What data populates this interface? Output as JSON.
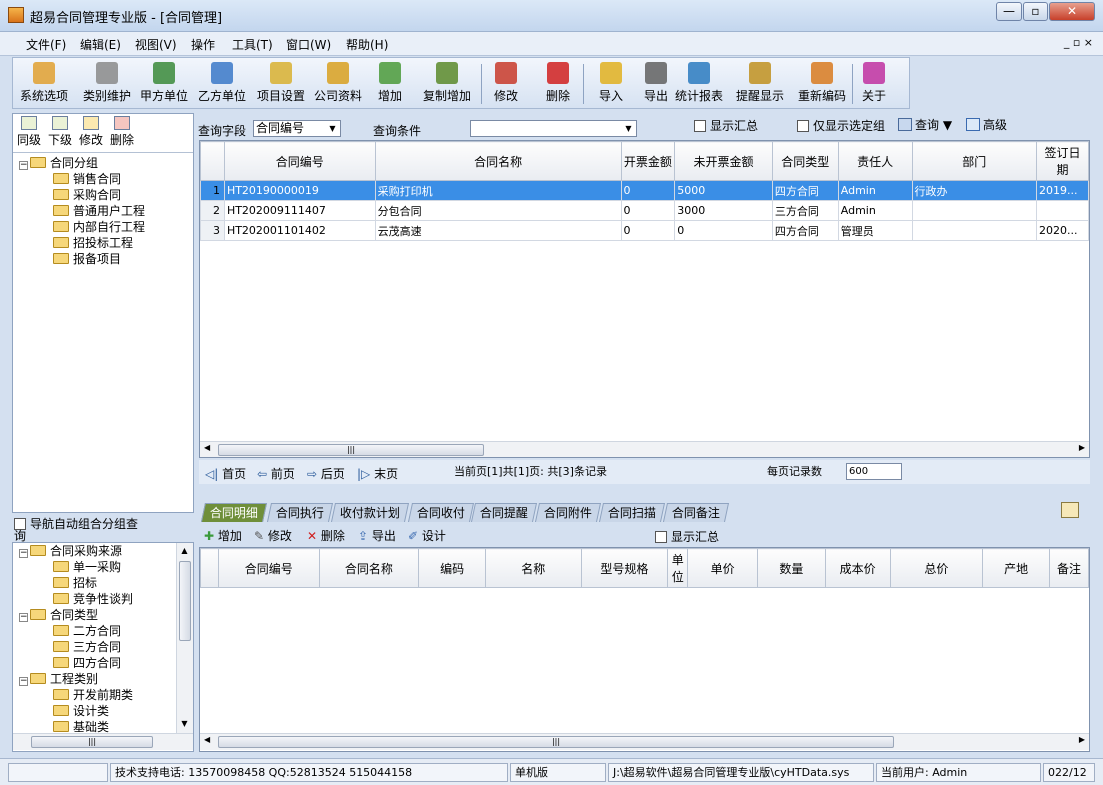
{
  "window": {
    "title": "超易合同管理专业版 - [合同管理]",
    "min": "0",
    "max": "1",
    "close": "r"
  },
  "menu": [
    "文件(F)",
    "编辑(E)",
    "视图(V)",
    "操作",
    "工具(T)",
    "窗口(W)",
    "帮助(H)"
  ],
  "mdi_controls": "_ ▫ ×",
  "toolbar": [
    {
      "label": "系统选项",
      "icon": "hammer-icon",
      "color": "#e0a030"
    },
    {
      "label": "类别维护",
      "icon": "tools-icon",
      "color": "#8a8a8a"
    },
    {
      "label": "甲方单位",
      "icon": "globe-user-icon",
      "color": "#3a8a3a"
    },
    {
      "label": "乙方单位",
      "icon": "user-icon",
      "color": "#3a78c8"
    },
    {
      "label": "项目设置",
      "icon": "coins-icon",
      "color": "#d8b030"
    },
    {
      "label": "公司资料",
      "icon": "money-icon",
      "color": "#d8a020"
    },
    {
      "label": "增加",
      "icon": "add-user-icon",
      "color": "#4a9a3a"
    },
    {
      "label": "复制增加",
      "icon": "copy-add-icon",
      "color": "#5a8a2a"
    },
    {
      "label": "修改",
      "icon": "pen-icon",
      "color": "#c83a2a"
    },
    {
      "label": "删除",
      "icon": "delete-x-icon",
      "color": "#d02020"
    },
    {
      "label": "导入",
      "icon": "folder-import-icon",
      "color": "#e0b020"
    },
    {
      "label": "导出",
      "icon": "printer-icon",
      "color": "#606060"
    },
    {
      "label": "统计报表",
      "icon": "bar-chart-icon",
      "color": "#2a7ac0"
    },
    {
      "label": "提醒显示",
      "icon": "warning-icon",
      "color": "#c09020"
    },
    {
      "label": "重新编码",
      "icon": "calculator-icon",
      "color": "#d87a20"
    },
    {
      "label": "关于",
      "icon": "question-icon",
      "color": "#c030a0"
    }
  ],
  "left_buttons": [
    "同级",
    "下级",
    "修改",
    "删除"
  ],
  "tree1": [
    {
      "label": "合同分组",
      "level": 0,
      "expand": "−"
    },
    {
      "label": "销售合同",
      "level": 1
    },
    {
      "label": "采购合同",
      "level": 1
    },
    {
      "label": "普通用户工程",
      "level": 1
    },
    {
      "label": "内部自行工程",
      "level": 1
    },
    {
      "label": "招投标工程",
      "level": 1
    },
    {
      "label": "报备项目",
      "level": 1
    }
  ],
  "nav_checkbox": "导航自动组合分组查询",
  "tree2": [
    {
      "label": "合同采购来源",
      "level": 0,
      "expand": "−"
    },
    {
      "label": "单一采购",
      "level": 1
    },
    {
      "label": "招标",
      "level": 1
    },
    {
      "label": "竞争性谈判",
      "level": 1
    },
    {
      "label": "合同类型",
      "level": 0,
      "expand": "−"
    },
    {
      "label": "二方合同",
      "level": 1
    },
    {
      "label": "三方合同",
      "level": 1
    },
    {
      "label": "四方合同",
      "level": 1
    },
    {
      "label": "工程类别",
      "level": 0,
      "expand": "−"
    },
    {
      "label": "开发前期类",
      "level": 1
    },
    {
      "label": "设计类",
      "level": 1
    },
    {
      "label": "基础类",
      "level": 1
    }
  ],
  "query": {
    "field_label": "查询字段",
    "field_value": "合同编号",
    "cond_label": "查询条件",
    "cond_value": "",
    "show_summary": "显示汇总",
    "only_selected": "仅显示选定组",
    "query_btn": "查询",
    "advanced_btn": "高级"
  },
  "grid1": {
    "columns": [
      "合同编号",
      "合同名称",
      "开票金额",
      "未开票金额",
      "合同类型",
      "责任人",
      "部门",
      "签订日期"
    ],
    "rows": [
      [
        "1",
        "HT20190000019",
        "采购打印机",
        "0",
        "5000",
        "四方合同",
        "Admin",
        "行政办",
        "2019..."
      ],
      [
        "2",
        "HT202009111407",
        "分包合同",
        "0",
        "3000",
        "三方合同",
        "Admin",
        "",
        ""
      ],
      [
        "3",
        "HT202001101402",
        "云茂高速",
        "0",
        "0",
        "四方合同",
        "管理员",
        "",
        "2020..."
      ]
    ]
  },
  "pager": {
    "first": "首页",
    "prev": "前页",
    "next": "后页",
    "last": "末页",
    "info": "当前页[1]共[1]页: 共[3]条记录",
    "per_page_label": "每页记录数",
    "per_page_value": "600"
  },
  "tabs": [
    "合同明细",
    "合同执行",
    "收付款计划",
    "合同收付",
    "合同提醒",
    "合同附件",
    "合同扫描",
    "合同备注"
  ],
  "subtoolbar": {
    "add": "增加",
    "edit": "修改",
    "delete": "删除",
    "export": "导出",
    "design": "设计",
    "show_summary": "显示汇总"
  },
  "grid2": {
    "columns": [
      "合同编号",
      "合同名称",
      "编码",
      "名称",
      "型号规格",
      "单位",
      "单价",
      "数量",
      "成本价",
      "总价",
      "产地",
      "备注"
    ]
  },
  "status": {
    "support": "技术支持电话: 13570098458 QQ:52813524 515044158",
    "mode": "单机版",
    "path": "J:\\超易软件\\超易合同管理专业版\\cyHTData.sys",
    "user": "当前用户: Admin",
    "date": "022/12"
  }
}
